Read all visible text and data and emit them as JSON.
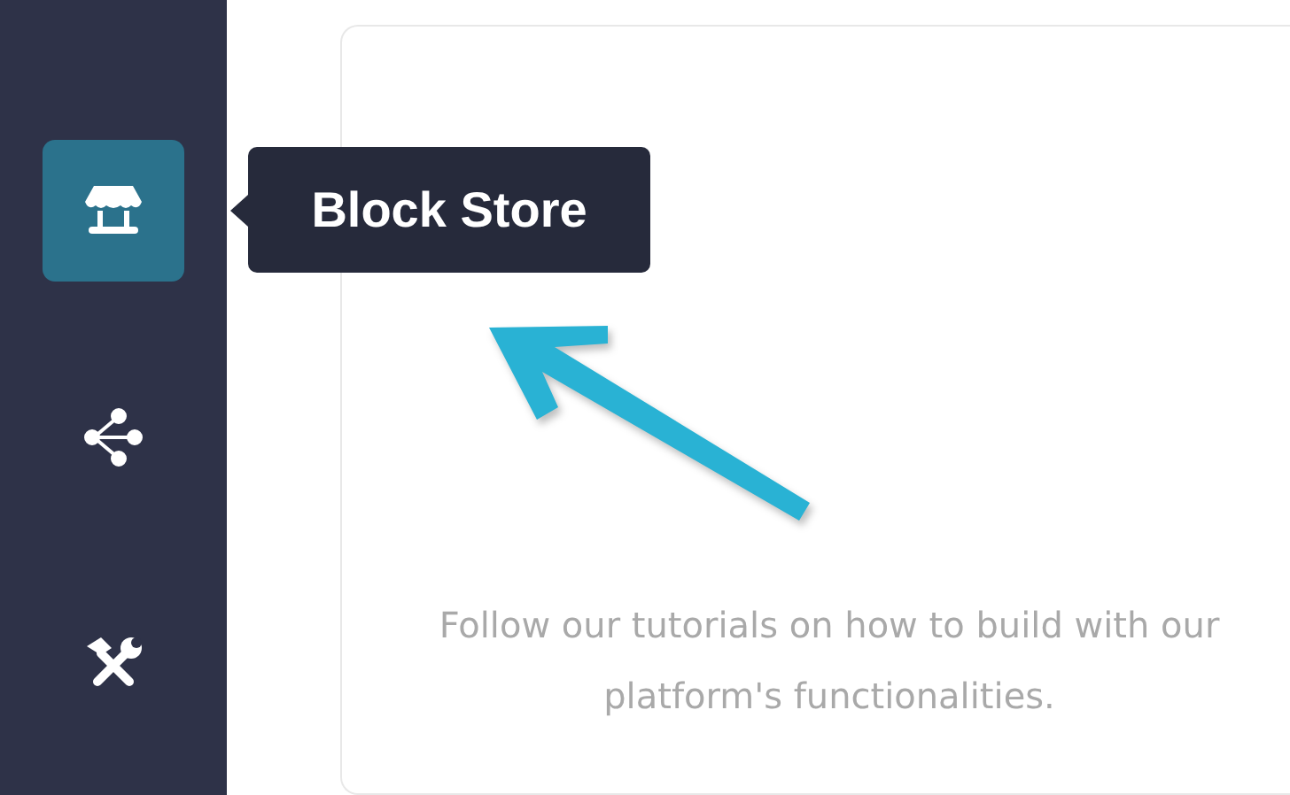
{
  "sidebar": {
    "items": [
      {
        "kind": "store",
        "selected": true
      },
      {
        "kind": "share",
        "selected": false
      },
      {
        "kind": "tools",
        "selected": false
      }
    ]
  },
  "tooltip": {
    "text": "Block Store"
  },
  "card": {
    "description": "Follow our tutorials on how to build with our platform's functionalities."
  }
}
